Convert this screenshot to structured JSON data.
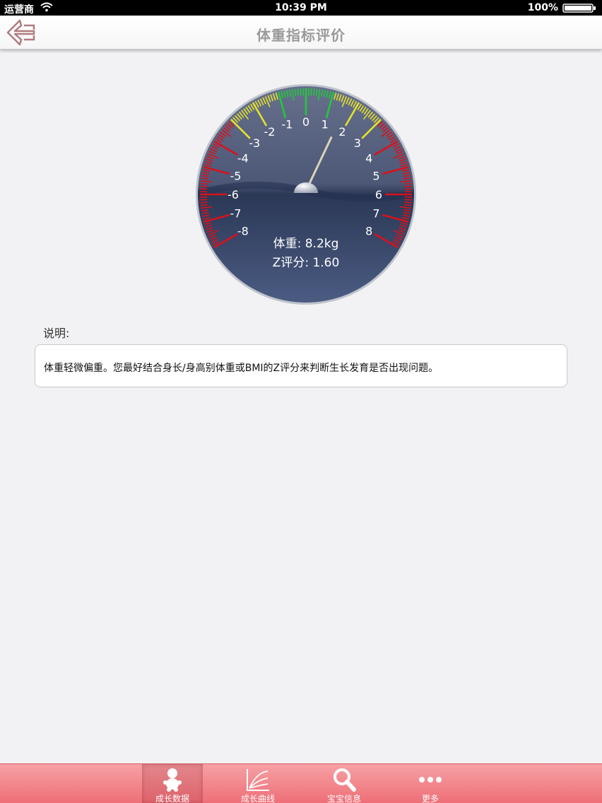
{
  "status": {
    "carrier": "运营商",
    "time": "10:39 PM",
    "battery": "100%"
  },
  "nav": {
    "title": "体重指标评价"
  },
  "gauge": {
    "weight_text": "体重: 8.2kg",
    "zscore_text": "Z评分: 1.60",
    "zscore_value": 1.6,
    "scale_labels": [
      "-8",
      "-7",
      "-6",
      "-5",
      "-4",
      "-3",
      "-2",
      "-1",
      "0",
      "1",
      "2",
      "3",
      "4",
      "5",
      "6",
      "7",
      "8"
    ],
    "colors": {
      "green": "#22c83a",
      "yellow": "#e5e22a",
      "red": "#d8121b",
      "face_top": "#4a5674",
      "face_bottom": "#2c3956"
    }
  },
  "description": {
    "label": "说明:",
    "text": "体重轻微偏重。您最好结合身长/身高别体重或BMI的Z评分来判断生长发育是否出现问题。"
  },
  "tabs": [
    {
      "label": "成长数据",
      "icon": "baby-icon",
      "active": true
    },
    {
      "label": "成长曲线",
      "icon": "chart-icon",
      "active": false
    },
    {
      "label": "宝宝信息",
      "icon": "search-icon",
      "active": false
    },
    {
      "label": "更多",
      "icon": "more-icon",
      "active": false
    }
  ],
  "accent": "#ee6f77"
}
